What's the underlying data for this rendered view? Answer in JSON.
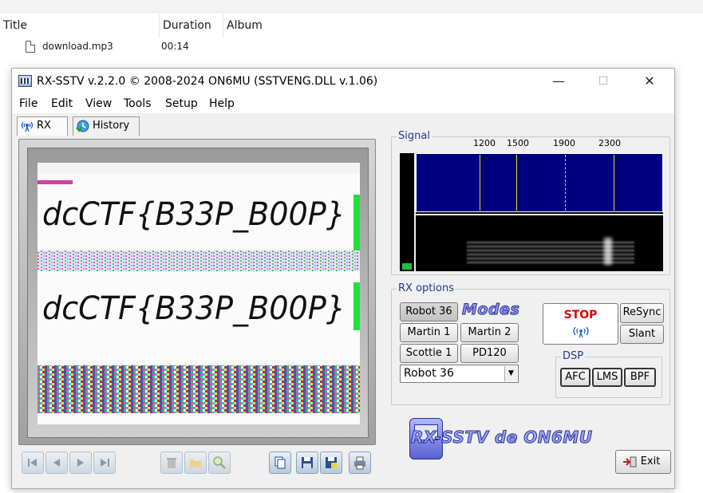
{
  "explorer": {
    "columns": [
      "Title",
      "Duration",
      "Album"
    ],
    "row": {
      "title": "download.mp3",
      "duration": "00:14"
    }
  },
  "window": {
    "title": "RX-SSTV v.2.2.0 © 2008-2024 ON6MU (SSTVENG.DLL v.1.06)",
    "controls": {
      "minimize": "—",
      "maximize": "☐",
      "close": "✕"
    }
  },
  "menu": [
    "File",
    "Edit",
    "View",
    "Tools",
    "Setup",
    "Help"
  ],
  "tabs": [
    {
      "label": "RX",
      "icon": "antenna-icon"
    },
    {
      "label": "History",
      "icon": "history-icon"
    }
  ],
  "decoded_image": {
    "text_line_1": "dcCTF{B33P_B00P}",
    "text_line_2": "dcCTF{B33P_B00P}"
  },
  "signal": {
    "label": "Signal",
    "freq_marks": [
      "1200",
      "1500",
      "1900",
      "2300"
    ]
  },
  "rx_options": {
    "label": "RX options",
    "modes_logo": "Modes",
    "mode_buttons": [
      "Robot 36",
      "Martin 1",
      "Martin 2",
      "Scottie 1",
      "PD120"
    ],
    "selected_mode": "Robot 36"
  },
  "controls": {
    "stop": "STOP",
    "resync": "ReSync",
    "slant": "Slant"
  },
  "dsp": {
    "label": "DSP",
    "buttons": [
      "AFC",
      "LMS",
      "BPF"
    ]
  },
  "brand": "RX-SSTV de ON6MU",
  "exit_label": "Exit",
  "colors": {
    "accent_blue": "#1f3a93",
    "stop_red": "#e00000",
    "spectrum_bg": "#000080"
  }
}
